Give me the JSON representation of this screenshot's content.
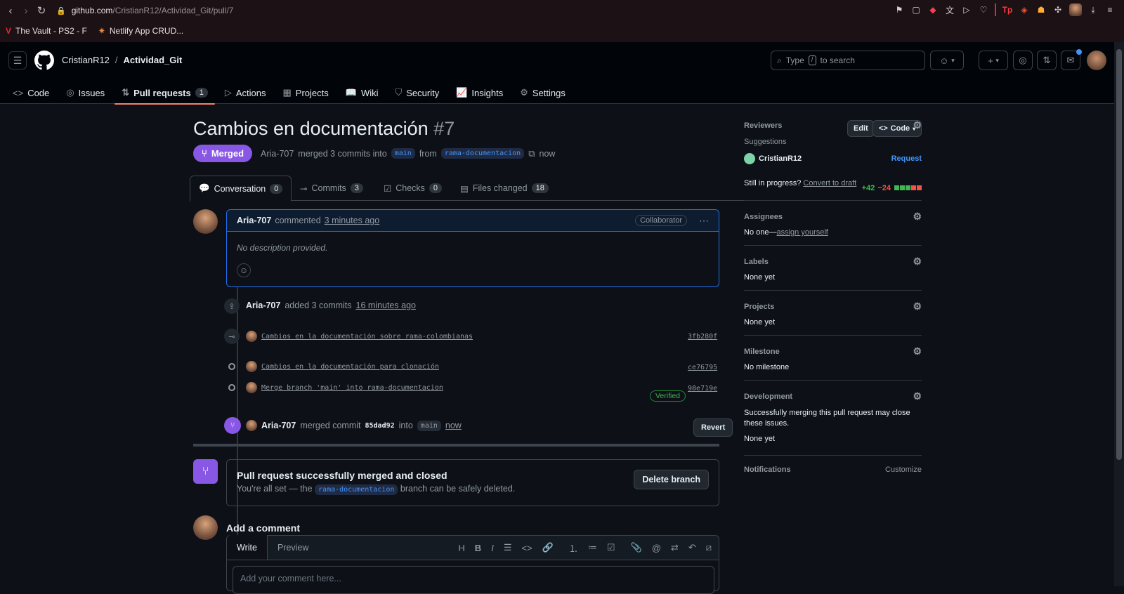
{
  "browser": {
    "url_host": "github.com",
    "url_path": "/CristianR12/Actividad_Git/pull/7",
    "bookmarks": [
      "The Vault - PS2 - F",
      "Netlify App CRUD..."
    ]
  },
  "header": {
    "owner": "CristianR12",
    "separator": "/",
    "repo": "Actividad_Git",
    "search_placeholder_pre": "Type",
    "search_kbd": "/",
    "search_placeholder_post": "to search"
  },
  "repo_nav": [
    {
      "label": "Code",
      "icon": "<>"
    },
    {
      "label": "Issues",
      "icon": "◎"
    },
    {
      "label": "Pull requests",
      "icon": "⇅",
      "count": "1"
    },
    {
      "label": "Actions",
      "icon": "▷"
    },
    {
      "label": "Projects",
      "icon": "▦"
    },
    {
      "label": "Wiki",
      "icon": "📖"
    },
    {
      "label": "Security",
      "icon": "⛉"
    },
    {
      "label": "Insights",
      "icon": "📈"
    },
    {
      "label": "Settings",
      "icon": "⚙"
    }
  ],
  "pr": {
    "title": "Cambios en documentación",
    "number": "#7",
    "edit_label": "Edit",
    "code_label": "Code",
    "status": "Merged",
    "author": "Aria-707",
    "meta_text": "merged 3 commits into",
    "base_branch": "main",
    "from_text": "from",
    "head_branch": "rama-documentacion",
    "time": "now"
  },
  "tabs": [
    {
      "label": "Conversation",
      "count": "0"
    },
    {
      "label": "Commits",
      "count": "3"
    },
    {
      "label": "Checks",
      "count": "0"
    },
    {
      "label": "Files changed",
      "count": "18"
    }
  ],
  "diffstat": {
    "added": "+42",
    "removed": "−24"
  },
  "comment": {
    "author": "Aria-707",
    "action": "commented",
    "time": "3 minutes ago",
    "badge": "Collaborator",
    "body": "No description provided."
  },
  "commits_event": {
    "author": "Aria-707",
    "action": "added 3 commits",
    "time": "16 minutes ago"
  },
  "commits": [
    {
      "message": "Cambios en la documentación sobre rama-colombianas",
      "sha": "3fb280f"
    },
    {
      "message": "Cambios en la documentación para clonación",
      "sha": "ce76795"
    },
    {
      "message": "Merge branch 'main' into rama-documentacion",
      "sha": "98e719e",
      "verified": "Verified"
    }
  ],
  "merge_event": {
    "author": "Aria-707",
    "action": "merged commit",
    "sha": "85dad92",
    "into": "into",
    "branch": "main",
    "time": "now",
    "revert_label": "Revert"
  },
  "merged_box": {
    "title": "Pull request successfully merged and closed",
    "pre": "You're all set — the",
    "branch": "rama-documentacion",
    "post": "branch can be safely deleted.",
    "delete_label": "Delete branch"
  },
  "add_comment": {
    "title": "Add a comment",
    "write": "Write",
    "preview": "Preview",
    "placeholder": "Add your comment here..."
  },
  "sidebar": {
    "reviewers": {
      "title": "Reviewers",
      "suggestions": "Suggestions",
      "user": "CristianR12",
      "request": "Request",
      "progress": "Still in progress?",
      "draft": "Convert to draft"
    },
    "assignees": {
      "title": "Assignees",
      "none": "No one—",
      "assign": "assign yourself"
    },
    "labels": {
      "title": "Labels",
      "value": "None yet"
    },
    "projects": {
      "title": "Projects",
      "value": "None yet"
    },
    "milestone": {
      "title": "Milestone",
      "value": "No milestone"
    },
    "development": {
      "title": "Development",
      "text": "Successfully merging this pull request may close these issues.",
      "value": "None yet"
    },
    "notifications": {
      "title": "Notifications",
      "customize": "Customize"
    }
  },
  "colors": {
    "merged": "#8957e5",
    "accent": "#4493f8",
    "success": "#3fb950",
    "danger": "#f85149",
    "tab_underline": "#f78166"
  }
}
